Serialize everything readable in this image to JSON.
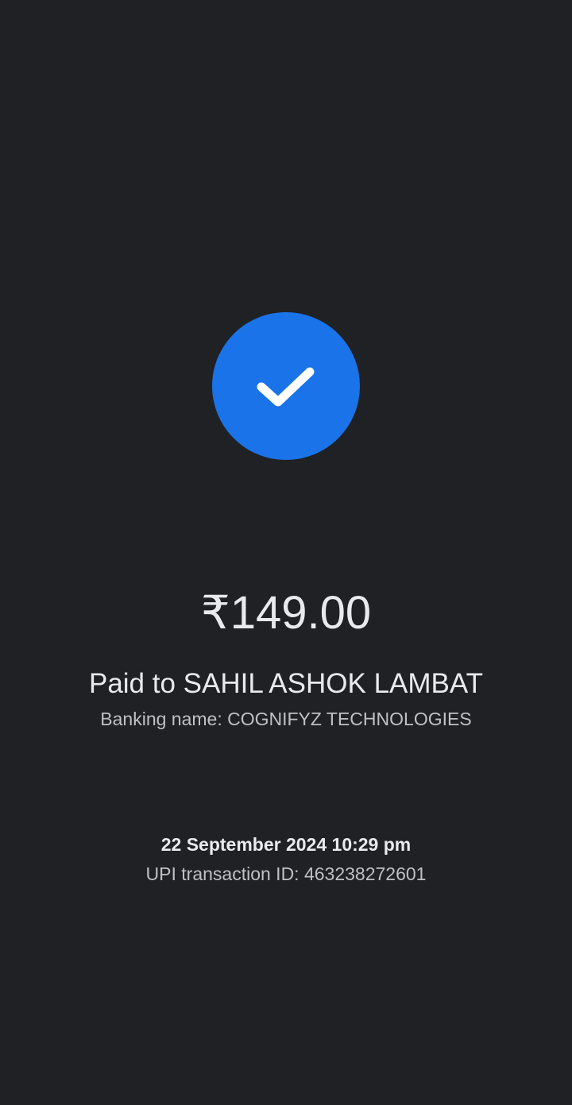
{
  "status": {
    "icon": "check-icon",
    "accent_color": "#1a73e8"
  },
  "payment": {
    "amount": "₹149.00",
    "paid_to": "Paid to SAHIL ASHOK LAMBAT",
    "banking_name": "Banking name: COGNIFYZ TECHNOLOGIES"
  },
  "transaction": {
    "datetime": "22 September 2024 10:29 pm",
    "upi_id": "UPI transaction ID: 463238272601"
  },
  "colors": {
    "background": "#202124",
    "primary_text": "#e8eaed",
    "secondary_text": "#bdc1c6"
  }
}
